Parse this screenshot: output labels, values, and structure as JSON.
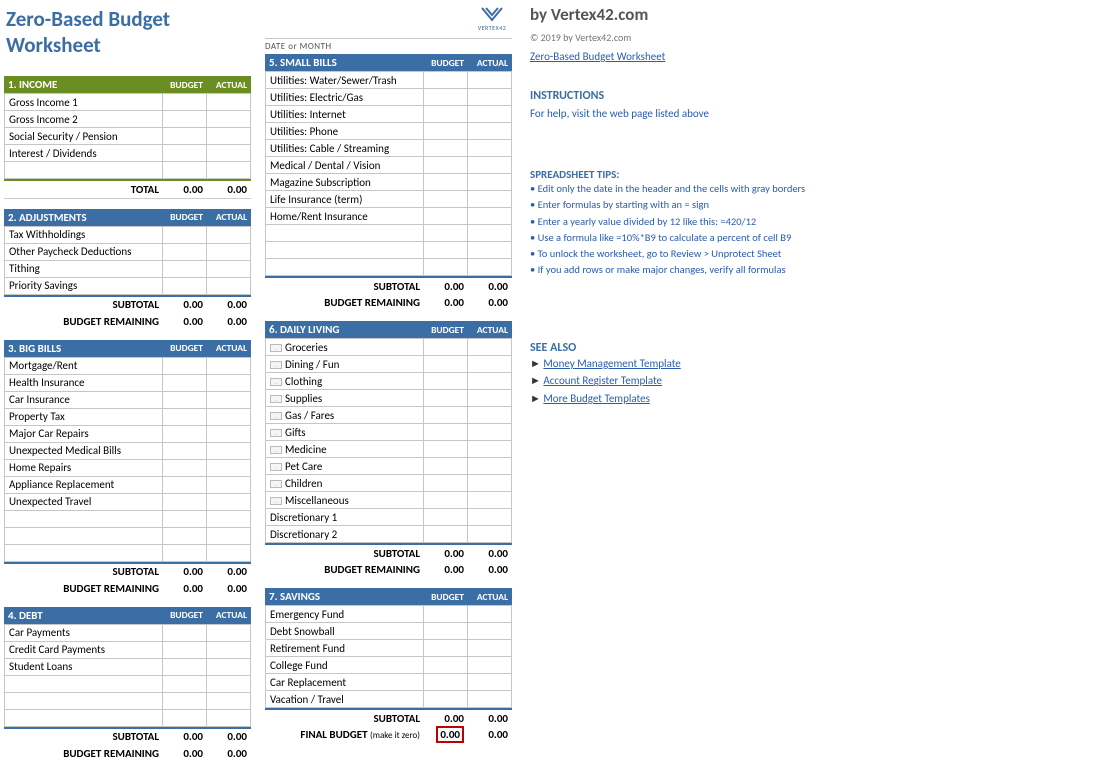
{
  "title": "Zero-Based Budget Worksheet",
  "date_label": "DATE  or MONTH",
  "logo_text": "VERTEX42",
  "col_budget": "BUDGET",
  "col_actual": "ACTUAL",
  "total_label": "TOTAL",
  "subtotal_label": "SUBTOTAL",
  "budrem_label": "BUDGET REMAINING",
  "final_label": "FINAL BUDGET",
  "final_note": "(make it zero)",
  "zero": "0.00",
  "sections": {
    "income": {
      "head": "1. INCOME",
      "items": [
        "Gross Income 1",
        "Gross Income 2",
        "Social Security / Pension",
        "Interest / Dividends",
        ""
      ]
    },
    "adjust": {
      "head": "2. ADJUSTMENTS",
      "items": [
        "Tax Withholdings",
        "Other Paycheck Deductions",
        "Tithing",
        "Priority Savings"
      ]
    },
    "bigbills": {
      "head": "3. BIG BILLS",
      "items": [
        "Mortgage/Rent",
        "Health Insurance",
        "Car Insurance",
        "Property Tax",
        "Major Car Repairs",
        "Unexpected Medical Bills",
        "Home Repairs",
        "Appliance Replacement",
        "Unexpected Travel",
        "",
        "",
        ""
      ]
    },
    "debt": {
      "head": "4. DEBT",
      "items": [
        "Car Payments",
        "Credit Card Payments",
        "Student Loans",
        "",
        "",
        ""
      ]
    },
    "small": {
      "head": "5. SMALL BILLS",
      "items": [
        "Utilities: Water/Sewer/Trash",
        "Utilities: Electric/Gas",
        "Utilities: Internet",
        "Utilities: Phone",
        "Utilities: Cable / Streaming",
        "Medical / Dental / Vision",
        "Magazine Subscription",
        "Life Insurance (term)",
        "Home/Rent Insurance",
        "",
        "",
        ""
      ]
    },
    "daily": {
      "head": "6. DAILY LIVING",
      "env": true,
      "items": [
        "Groceries",
        "Dining / Fun",
        "Clothing",
        "Supplies",
        "Gas / Fares",
        "Gifts",
        "Medicine",
        "Pet Care",
        "Children",
        "Miscellaneous",
        "Discretionary 1",
        "Discretionary 2"
      ]
    },
    "savings": {
      "head": "7. SAVINGS",
      "items": [
        "Emergency Fund",
        "Debt Snowball",
        "Retirement Fund",
        "College Fund",
        "Car Replacement",
        "Vacation / Travel"
      ]
    }
  },
  "side": {
    "by": "by Vertex42.com",
    "copy": "© 2019 by Vertex42.com",
    "link": "Zero-Based Budget Worksheet",
    "instr_h": "INSTRUCTIONS",
    "instr_t": "For help, visit the web page listed above",
    "tips_h": "SPREADSHEET TIPS:",
    "tips": [
      "• Edit only the date in the header and the cells with gray borders",
      "• Enter formulas by starting with an = sign",
      "• Enter a yearly value divided by 12 like this: =420/12",
      "• Use a formula like =10%*B9 to calculate a percent of cell B9",
      "• To unlock the worksheet, go to Review > Unprotect Sheet",
      "• If you add rows or make major changes, verify all formulas"
    ],
    "seealso_h": "SEE ALSO",
    "seealso": [
      "Money Management Template",
      "Account Register Template",
      "More Budget Templates"
    ]
  }
}
